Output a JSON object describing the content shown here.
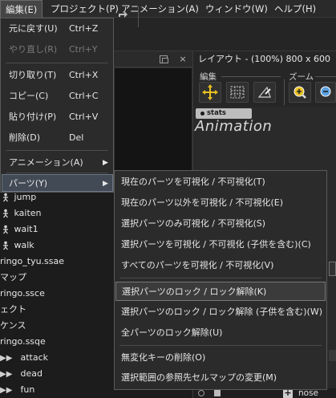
{
  "menubar": {
    "items": [
      {
        "label": "編集(E)",
        "active": true
      },
      {
        "label": "プロジェクト(P)"
      },
      {
        "label": "アニメーション(A)"
      },
      {
        "label": "ウィンドウ(W)"
      },
      {
        "label": "ヘルプ(H)"
      }
    ]
  },
  "left_panel": {
    "close_label": "×",
    "tree": [
      {
        "icon": "person-icon",
        "label": "jump"
      },
      {
        "icon": "person-icon",
        "label": "kaiten"
      },
      {
        "icon": "person-icon",
        "label": "wait1"
      },
      {
        "icon": "person-icon",
        "label": "walk"
      },
      {
        "icon": "",
        "label": "ringo_tyu.ssae"
      },
      {
        "icon": "",
        "label": "マップ"
      },
      {
        "icon": "",
        "label": "ringo.ssce"
      },
      {
        "icon": "",
        "label": "ェクト"
      },
      {
        "icon": "",
        "label": "ケンス"
      },
      {
        "icon": "",
        "label": "ringo.ssqe"
      },
      {
        "icon": "play-icon",
        "label": "attack"
      },
      {
        "icon": "play-icon",
        "label": "dead"
      },
      {
        "icon": "play-icon",
        "label": "fun"
      }
    ]
  },
  "layout_panel": {
    "title": "レイアウト - (100%) 800 x 600",
    "close_label": "×",
    "group_edit": "編集",
    "group_zoom": "ズーム",
    "stats_tag": "stats",
    "animation_label": "Animation",
    "bottom_label": "nose"
  },
  "edit_menu": {
    "items": [
      {
        "label": "元に戻す(U)",
        "shortcut": "Ctrl+Z",
        "disabled": false
      },
      {
        "label": "やり直し(R)",
        "shortcut": "Ctrl+Y",
        "disabled": true
      },
      {
        "label": "切り取り(T)",
        "shortcut": "Ctrl+X",
        "disabled": false
      },
      {
        "label": "コピー(C)",
        "shortcut": "Ctrl+C",
        "disabled": false
      },
      {
        "label": "貼り付け(P)",
        "shortcut": "Ctrl+V",
        "disabled": false
      },
      {
        "label": "削除(D)",
        "shortcut": "Del",
        "disabled": false
      },
      {
        "label": "アニメーション(A)",
        "shortcut": "",
        "disabled": false,
        "submenu": true
      },
      {
        "label": "パーツ(Y)",
        "shortcut": "",
        "disabled": false,
        "submenu": true,
        "highlighted": true
      }
    ],
    "submenu_arrow": "▶"
  },
  "parts_submenu": {
    "items": [
      {
        "label": "現在のパーツを可視化 / 不可視化(T)"
      },
      {
        "label": "現在のパーツ以外を可視化 / 不可視化(E)"
      },
      {
        "label": "選択パーツのみ可視化 / 不可視化(S)"
      },
      {
        "label": "選択パーツを可視化 / 不可視化 (子供を含む)(C)"
      },
      {
        "label": "すべてのパーツを可視化 / 不可視化(V)"
      },
      {
        "label": "選択パーツのロック / ロック解除(K)",
        "highlighted": true
      },
      {
        "label": "選択パーツのロック / ロック解除 (子供を含む)(W)"
      },
      {
        "label": "全パーツのロック解除(U)"
      },
      {
        "label": "無変化キーの削除(O)"
      },
      {
        "label": "選択範囲の参照先セルマップの変更(M)"
      }
    ]
  },
  "colors": {
    "menu_bg": "#2b2b2b",
    "highlight": "#424a56",
    "accent_tool": "#e8c020"
  }
}
